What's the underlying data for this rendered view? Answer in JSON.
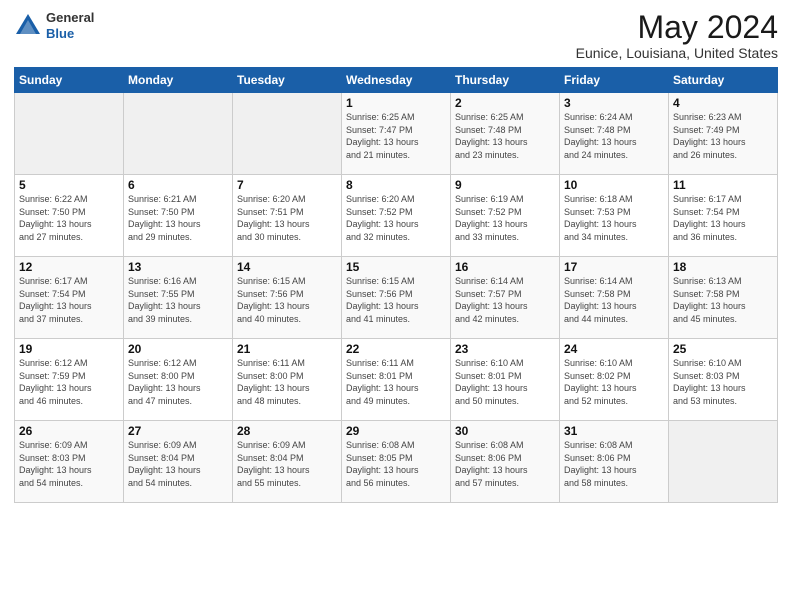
{
  "logo": {
    "general": "General",
    "blue": "Blue"
  },
  "title": "May 2024",
  "subtitle": "Eunice, Louisiana, United States",
  "days_of_week": [
    "Sunday",
    "Monday",
    "Tuesday",
    "Wednesday",
    "Thursday",
    "Friday",
    "Saturday"
  ],
  "weeks": [
    [
      {
        "day": "",
        "info": ""
      },
      {
        "day": "",
        "info": ""
      },
      {
        "day": "",
        "info": ""
      },
      {
        "day": "1",
        "info": "Sunrise: 6:25 AM\nSunset: 7:47 PM\nDaylight: 13 hours\nand 21 minutes."
      },
      {
        "day": "2",
        "info": "Sunrise: 6:25 AM\nSunset: 7:48 PM\nDaylight: 13 hours\nand 23 minutes."
      },
      {
        "day": "3",
        "info": "Sunrise: 6:24 AM\nSunset: 7:48 PM\nDaylight: 13 hours\nand 24 minutes."
      },
      {
        "day": "4",
        "info": "Sunrise: 6:23 AM\nSunset: 7:49 PM\nDaylight: 13 hours\nand 26 minutes."
      }
    ],
    [
      {
        "day": "5",
        "info": "Sunrise: 6:22 AM\nSunset: 7:50 PM\nDaylight: 13 hours\nand 27 minutes."
      },
      {
        "day": "6",
        "info": "Sunrise: 6:21 AM\nSunset: 7:50 PM\nDaylight: 13 hours\nand 29 minutes."
      },
      {
        "day": "7",
        "info": "Sunrise: 6:20 AM\nSunset: 7:51 PM\nDaylight: 13 hours\nand 30 minutes."
      },
      {
        "day": "8",
        "info": "Sunrise: 6:20 AM\nSunset: 7:52 PM\nDaylight: 13 hours\nand 32 minutes."
      },
      {
        "day": "9",
        "info": "Sunrise: 6:19 AM\nSunset: 7:52 PM\nDaylight: 13 hours\nand 33 minutes."
      },
      {
        "day": "10",
        "info": "Sunrise: 6:18 AM\nSunset: 7:53 PM\nDaylight: 13 hours\nand 34 minutes."
      },
      {
        "day": "11",
        "info": "Sunrise: 6:17 AM\nSunset: 7:54 PM\nDaylight: 13 hours\nand 36 minutes."
      }
    ],
    [
      {
        "day": "12",
        "info": "Sunrise: 6:17 AM\nSunset: 7:54 PM\nDaylight: 13 hours\nand 37 minutes."
      },
      {
        "day": "13",
        "info": "Sunrise: 6:16 AM\nSunset: 7:55 PM\nDaylight: 13 hours\nand 39 minutes."
      },
      {
        "day": "14",
        "info": "Sunrise: 6:15 AM\nSunset: 7:56 PM\nDaylight: 13 hours\nand 40 minutes."
      },
      {
        "day": "15",
        "info": "Sunrise: 6:15 AM\nSunset: 7:56 PM\nDaylight: 13 hours\nand 41 minutes."
      },
      {
        "day": "16",
        "info": "Sunrise: 6:14 AM\nSunset: 7:57 PM\nDaylight: 13 hours\nand 42 minutes."
      },
      {
        "day": "17",
        "info": "Sunrise: 6:14 AM\nSunset: 7:58 PM\nDaylight: 13 hours\nand 44 minutes."
      },
      {
        "day": "18",
        "info": "Sunrise: 6:13 AM\nSunset: 7:58 PM\nDaylight: 13 hours\nand 45 minutes."
      }
    ],
    [
      {
        "day": "19",
        "info": "Sunrise: 6:12 AM\nSunset: 7:59 PM\nDaylight: 13 hours\nand 46 minutes."
      },
      {
        "day": "20",
        "info": "Sunrise: 6:12 AM\nSunset: 8:00 PM\nDaylight: 13 hours\nand 47 minutes."
      },
      {
        "day": "21",
        "info": "Sunrise: 6:11 AM\nSunset: 8:00 PM\nDaylight: 13 hours\nand 48 minutes."
      },
      {
        "day": "22",
        "info": "Sunrise: 6:11 AM\nSunset: 8:01 PM\nDaylight: 13 hours\nand 49 minutes."
      },
      {
        "day": "23",
        "info": "Sunrise: 6:10 AM\nSunset: 8:01 PM\nDaylight: 13 hours\nand 50 minutes."
      },
      {
        "day": "24",
        "info": "Sunrise: 6:10 AM\nSunset: 8:02 PM\nDaylight: 13 hours\nand 52 minutes."
      },
      {
        "day": "25",
        "info": "Sunrise: 6:10 AM\nSunset: 8:03 PM\nDaylight: 13 hours\nand 53 minutes."
      }
    ],
    [
      {
        "day": "26",
        "info": "Sunrise: 6:09 AM\nSunset: 8:03 PM\nDaylight: 13 hours\nand 54 minutes."
      },
      {
        "day": "27",
        "info": "Sunrise: 6:09 AM\nSunset: 8:04 PM\nDaylight: 13 hours\nand 54 minutes."
      },
      {
        "day": "28",
        "info": "Sunrise: 6:09 AM\nSunset: 8:04 PM\nDaylight: 13 hours\nand 55 minutes."
      },
      {
        "day": "29",
        "info": "Sunrise: 6:08 AM\nSunset: 8:05 PM\nDaylight: 13 hours\nand 56 minutes."
      },
      {
        "day": "30",
        "info": "Sunrise: 6:08 AM\nSunset: 8:06 PM\nDaylight: 13 hours\nand 57 minutes."
      },
      {
        "day": "31",
        "info": "Sunrise: 6:08 AM\nSunset: 8:06 PM\nDaylight: 13 hours\nand 58 minutes."
      },
      {
        "day": "",
        "info": ""
      }
    ]
  ]
}
